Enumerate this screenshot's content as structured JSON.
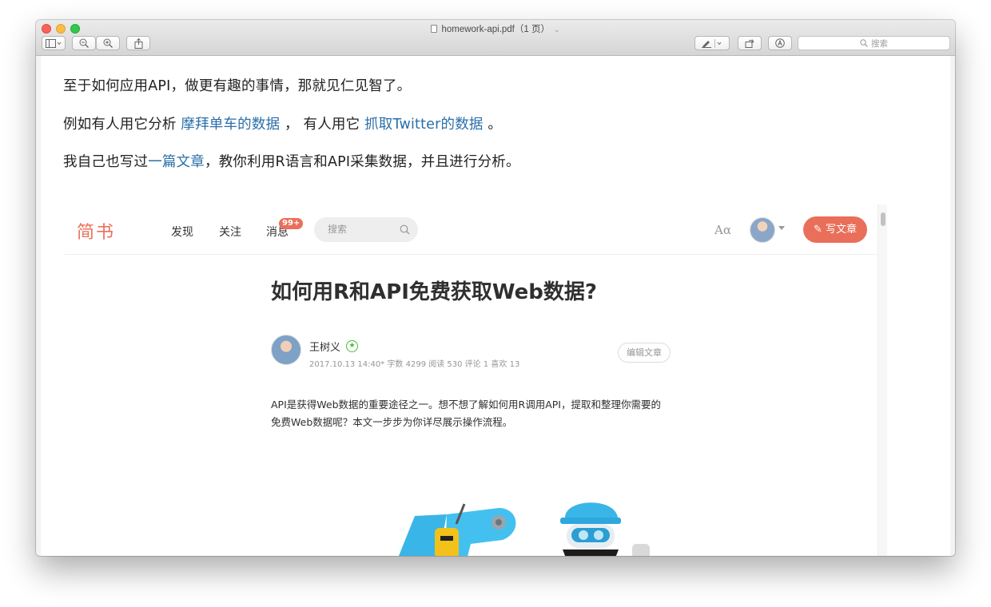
{
  "window": {
    "title": "homework-api.pdf（1 页）"
  },
  "toolbar": {
    "search_placeholder": "搜索",
    "sidebar_toggle": "sidebar-icon",
    "zoom_out": "zoom-out-icon",
    "zoom_in": "zoom-in-icon",
    "share": "share-icon",
    "markup_pen": "pen-icon",
    "rotate": "rotate-icon",
    "annotate": "annotate-icon"
  },
  "doc": {
    "line1": "至于如何应用API，做更有趣的事情，那就见仁见智了。",
    "line2": {
      "prefix": "例如有人用它分析 ",
      "link1": "摩拜单车的数据",
      "mid": " ， 有人用它 ",
      "link2": "抓取Twitter的数据",
      "suffix": " 。"
    },
    "line3": {
      "prefix": "我自己也写过",
      "link": "一篇文章",
      "suffix": "，教你利用R语言和API采集数据，并且进行分析。"
    }
  },
  "jianshu": {
    "logo": "简书",
    "nav": [
      "发现",
      "关注",
      "消息"
    ],
    "badge": "99+",
    "search_placeholder": "搜索",
    "aa_label": "Aα",
    "write_button": "写文章",
    "article": {
      "title": "如何用R和API免费获取Web数据?",
      "author": "王树义",
      "meta": "2017.10.13 14:40*  字数 4299  阅读 530  评论 1  喜欢 13",
      "edit_button": "编辑文章",
      "summary": "API是获得Web数据的重要途径之一。想不想了解如何用R调用API，提取和整理你需要的免费Web数据呢？本文一步步为你详尽展示操作流程。"
    }
  },
  "colors": {
    "jianshu_accent": "#ea6f5a",
    "link": "#2a6ea8",
    "verified": "#42c02e"
  }
}
